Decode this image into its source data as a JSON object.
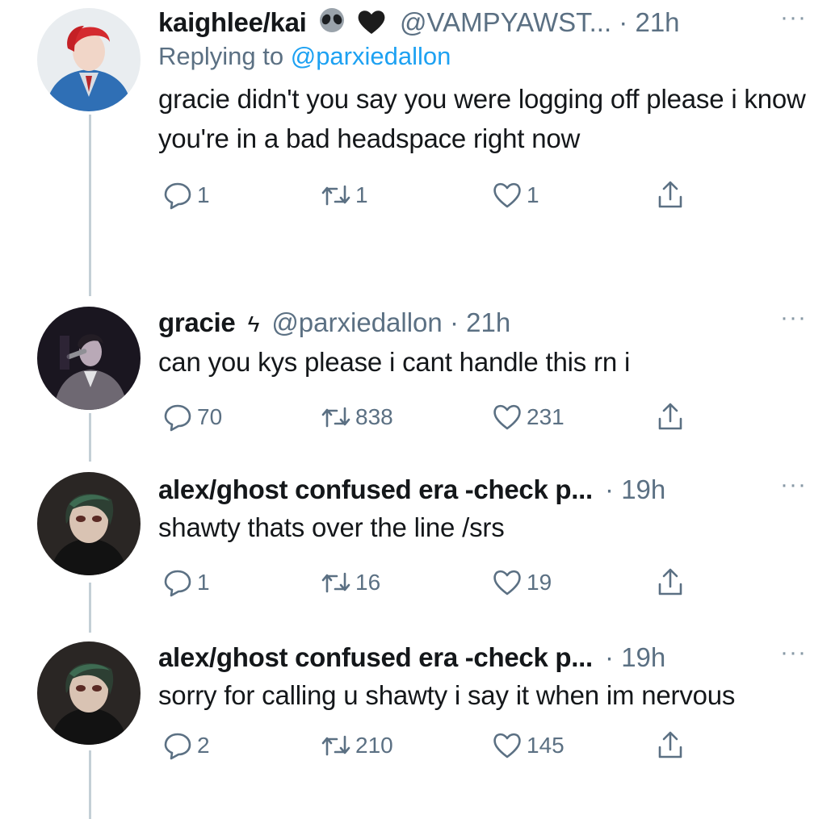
{
  "tweets": [
    {
      "name": "kaighlee/kai",
      "emojis": [
        "alien-emoji",
        "black-heart-emoji"
      ],
      "handle": "@VAMPYAWST...",
      "dot": "·",
      "time": "21h",
      "reply_prefix": "Replying to ",
      "reply_handle": "@parxiedallon",
      "text": "gracie didn't you say you were logging off please i know you're in a bad headspace right now",
      "replies": "1",
      "retweets": "1",
      "likes": "1"
    },
    {
      "name": "gracie",
      "name_symbol": "ϟ",
      "handle": "@parxiedallon",
      "dot": "·",
      "time": "21h",
      "text": "can you kys please i cant handle this rn i",
      "replies": "70",
      "retweets": "838",
      "likes": "231"
    },
    {
      "name": "alex/ghost confused era -check p...",
      "dot": "·",
      "time": "19h",
      "text": "shawty thats over the line /srs",
      "replies": "1",
      "retweets": "16",
      "likes": "19"
    },
    {
      "name": "alex/ghost confused era -check p...",
      "dot": "·",
      "time": "19h",
      "text": "sorry for calling u shawty i say it when im nervous",
      "replies": "2",
      "retweets": "210",
      "likes": "145"
    }
  ],
  "more_label": "···",
  "colors": {
    "text": "#14171a",
    "secondary": "#5b7083",
    "link": "#1da1f2",
    "thread_line": "#c4cfd6"
  }
}
